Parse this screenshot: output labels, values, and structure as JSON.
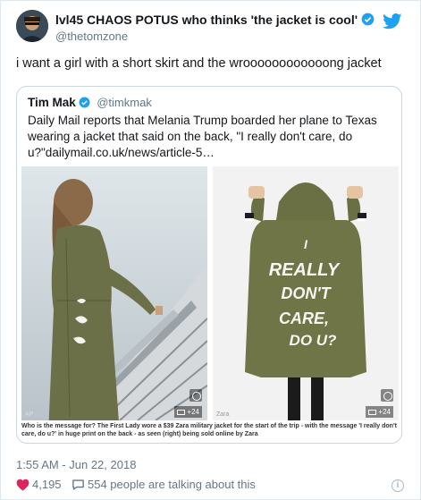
{
  "tweet": {
    "author_name": "lvl45 CHAOS POTUS who thinks 'the jacket is cool'",
    "author_handle": "@thetomzone",
    "text": "i want a girl with a short skirt and the wroooooooooooong jacket",
    "timestamp": "1:55 AM - Jun 22, 2018",
    "likes": "4,195",
    "talking": "554 people are talking about this",
    "icons": [
      "verified-badge-icon",
      "twitter-bird-icon",
      "heart-icon",
      "comment-icon",
      "info-icon"
    ],
    "colors": {
      "link_blue": "#1da1f2",
      "like_red": "#e0245e",
      "muted": "#657786"
    }
  },
  "quote": {
    "author_name": "Tim Mak",
    "author_handle": "@timkmak",
    "text": "Daily Mail reports that Melania Trump boarded her plane to Texas wearing a jacket that said on the back, \"I really don't care, do u?\"dailymail.co.uk/news/article-5…",
    "media": {
      "left_credit": "AP",
      "left_count": "+24",
      "right_credit": "Zara",
      "right_count": "+24",
      "jacket_message": [
        "I",
        "REALLY",
        "DON'T",
        "CARE,",
        "DO U?"
      ],
      "caption": "Who is the message for? The First Lady wore a $39 Zara military jacket for the start of the trip - with the message 'I really don't care, do u?' in huge print on the back - as seen (right) being sold online by Zara"
    }
  }
}
